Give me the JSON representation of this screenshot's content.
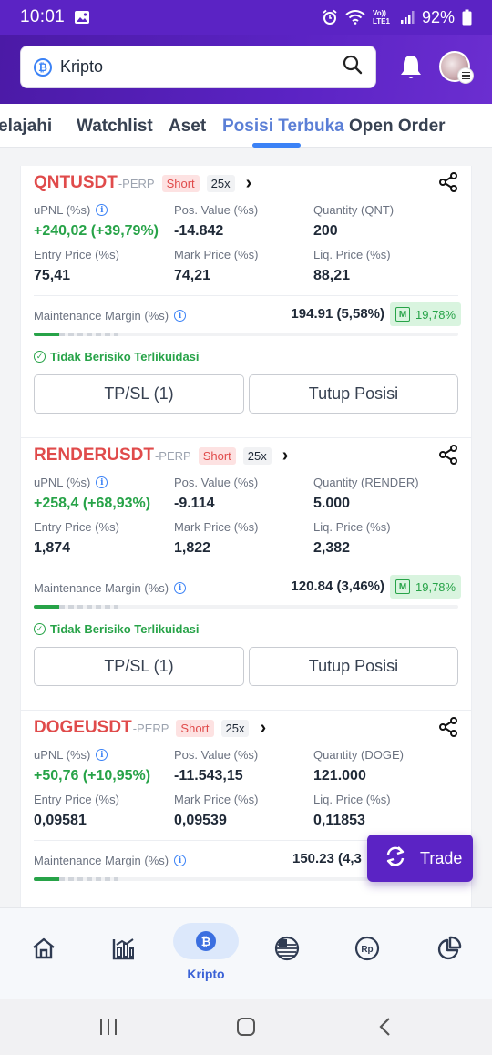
{
  "status_bar": {
    "time": "10:01",
    "network": "Vo)) LTE1",
    "battery": "92%"
  },
  "search": {
    "value": "Kripto",
    "coin_glyph": "₿"
  },
  "tabs": [
    {
      "label": "elajahi",
      "active": false
    },
    {
      "label": "Watchlist",
      "active": false
    },
    {
      "label": "Aset",
      "active": false
    },
    {
      "label": "Posisi Terbuka",
      "active": true
    },
    {
      "label": "Open Order",
      "active": false
    }
  ],
  "labels": {
    "upnl": "uPNL (%s)",
    "pos_value": "Pos. Value (%s)",
    "entry_price": "Entry Price (%s)",
    "mark_price": "Mark Price (%s)",
    "liq_price": "Liq. Price (%s)",
    "maintenance_margin": "Maintenance Margin (%s)",
    "safe_status": "Tidak Berisiko Terlikuidasi",
    "tpsl_button": "TP/SL (1)",
    "close_button": "Tutup Posisi"
  },
  "positions": [
    {
      "symbol": "QNTUSDT",
      "suffix": "-PERP",
      "side": "Short",
      "leverage": "25x",
      "upnl": "+240,02 (+39,79%)",
      "pos_value": "-14.842",
      "quantity_label": "Quantity (QNT)",
      "quantity": "200",
      "entry_price": "75,41",
      "mark_price": "74,21",
      "liq_price": "88,21",
      "mm_value": "194.91 (5,58%)",
      "mm_ratio": "19,78%",
      "risk_fill": 0.06
    },
    {
      "symbol": "RENDERUSDT",
      "suffix": "-PERP",
      "side": "Short",
      "leverage": "25x",
      "upnl": "+258,4 (+68,93%)",
      "pos_value": "-9.114",
      "quantity_label": "Quantity (RENDER)",
      "quantity": "5.000",
      "entry_price": "1,874",
      "mark_price": "1,822",
      "liq_price": "2,382",
      "mm_value": "120.84 (3,46%)",
      "mm_ratio": "19,78%",
      "risk_fill": 0.06
    },
    {
      "symbol": "DOGEUSDT",
      "suffix": "-PERP",
      "side": "Short",
      "leverage": "25x",
      "upnl": "+50,76 (+10,95%)",
      "pos_value": "-11.543,15",
      "quantity_label": "Quantity (DOGE)",
      "quantity": "121.000",
      "entry_price": "0,09581",
      "mark_price": "0,09539",
      "liq_price": "0,11853",
      "mm_value": "150.23 (4,3",
      "risk_fill": 0.06
    }
  ],
  "trade_button": "Trade",
  "bottom_nav": {
    "active_label": "Kripto",
    "coin_glyph": "₿",
    "rp_glyph": "Rp"
  },
  "colors": {
    "brand_purple": "#5b23c4",
    "short_red": "#e04b4b",
    "profit_green": "#27a348",
    "tab_blue": "#3b82f6"
  }
}
